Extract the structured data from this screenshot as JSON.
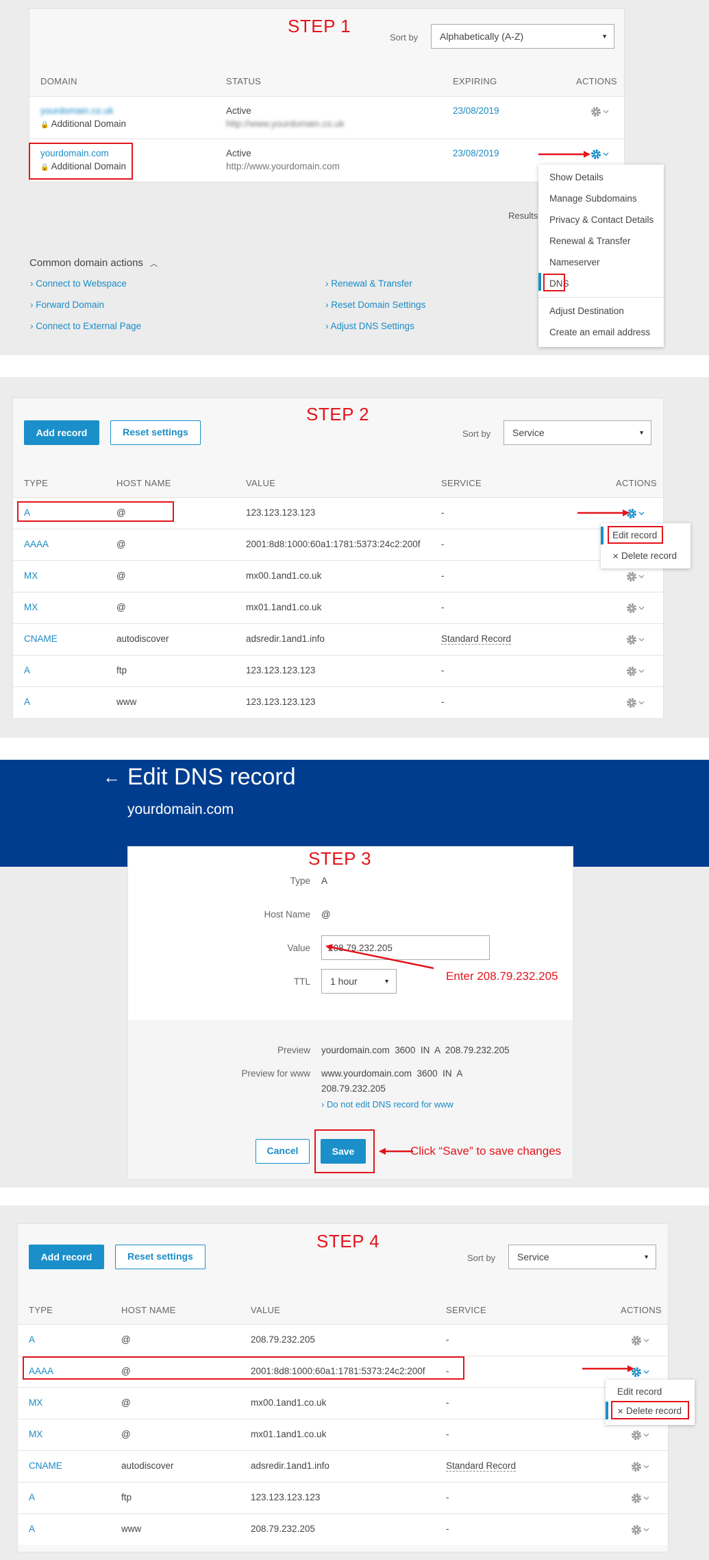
{
  "colors": {
    "accent": "#1a8fc9",
    "link": "#1a8cc6",
    "annotation": "#e3141b",
    "header_bg": "#003d8f"
  },
  "step1": {
    "title": "STEP 1",
    "sort_label": "Sort by",
    "sort_value": "Alphabetically (A-Z)",
    "headers": {
      "domain": "DOMAIN",
      "status": "STATUS",
      "expiring": "EXPIRING",
      "actions": "ACTIONS"
    },
    "rows": [
      {
        "domain": "yourdomain.co.uk",
        "sub": "Additional Domain",
        "status": "Active",
        "url": "http://www.yourdomain.co.uk",
        "expiring": "23/08/2019"
      },
      {
        "domain": "yourdomain.com",
        "sub": "Additional Domain",
        "status": "Active",
        "url": "http://www.yourdomain.com",
        "expiring": "23/08/2019"
      }
    ],
    "results_label": "Results",
    "common_title": "Common domain actions",
    "links_left": [
      "Connect to Webspace",
      "Forward Domain",
      "Connect to External Page"
    ],
    "links_right": [
      "Renewal & Transfer",
      "Reset Domain Settings",
      "Adjust DNS Settings"
    ],
    "menu": [
      "Show Details",
      "Manage Subdomains",
      "Privacy & Contact Details",
      "Renewal & Transfer",
      "Nameserver",
      "DNS",
      "Adjust Destination",
      "Create an email address"
    ]
  },
  "step2": {
    "title": "STEP 2",
    "add_record": "Add record",
    "reset_settings": "Reset settings",
    "sort_label": "Sort by",
    "sort_value": "Service",
    "headers": {
      "type": "TYPE",
      "host": "HOST NAME",
      "value": "VALUE",
      "service": "SERVICE",
      "actions": "ACTIONS"
    },
    "rows": [
      {
        "type": "A",
        "host": "@",
        "value": "123.123.123.123",
        "service": "-"
      },
      {
        "type": "AAAA",
        "host": "@",
        "value": "2001:8d8:1000:60a1:1781:5373:24c2:200f",
        "service": "-"
      },
      {
        "type": "MX",
        "host": "@",
        "value": "mx00.1and1.co.uk",
        "service": "-"
      },
      {
        "type": "MX",
        "host": "@",
        "value": "mx01.1and1.co.uk",
        "service": "-"
      },
      {
        "type": "CNAME",
        "host": "autodiscover",
        "value": "adsredir.1and1.info",
        "service": "Standard Record"
      },
      {
        "type": "A",
        "host": "ftp",
        "value": "123.123.123.123",
        "service": "-"
      },
      {
        "type": "A",
        "host": "www",
        "value": "123.123.123.123",
        "service": "-"
      }
    ],
    "menu": [
      "Edit record",
      "Delete record"
    ]
  },
  "step3": {
    "page_title": "Edit DNS record",
    "domain": "yourdomain.com",
    "title": "STEP 3",
    "type_label": "Type",
    "type_value": "A",
    "host_label": "Host Name",
    "host_value": "@",
    "value_label": "Value",
    "value_value": "208.79.232.205",
    "ttl_label": "TTL",
    "ttl_value": "1 hour",
    "annotation_value": "Enter 208.79.232.205",
    "preview_label": "Preview",
    "preview_value": "yourdomain.com  3600  IN  A  208.79.232.205",
    "preview_www_label": "Preview for www",
    "preview_www_line1": "www.yourdomain.com  3600  IN  A",
    "preview_www_line2": "208.79.232.205",
    "no_edit_www": "Do not edit DNS record for www",
    "cancel": "Cancel",
    "save": "Save",
    "annotation_save": "Click “Save” to save changes"
  },
  "step4": {
    "title": "STEP 4",
    "add_record": "Add record",
    "reset_settings": "Reset settings",
    "sort_label": "Sort by",
    "sort_value": "Service",
    "headers": {
      "type": "TYPE",
      "host": "HOST NAME",
      "value": "VALUE",
      "service": "SERVICE",
      "actions": "ACTIONS"
    },
    "rows": [
      {
        "type": "A",
        "host": "@",
        "value": "208.79.232.205",
        "service": "-"
      },
      {
        "type": "AAAA",
        "host": "@",
        "value": "2001:8d8:1000:60a1:1781:5373:24c2:200f",
        "service": "-"
      },
      {
        "type": "MX",
        "host": "@",
        "value": "mx00.1and1.co.uk",
        "service": "-"
      },
      {
        "type": "MX",
        "host": "@",
        "value": "mx01.1and1.co.uk",
        "service": "-"
      },
      {
        "type": "CNAME",
        "host": "autodiscover",
        "value": "adsredir.1and1.info",
        "service": "Standard Record"
      },
      {
        "type": "A",
        "host": "ftp",
        "value": "123.123.123.123",
        "service": "-"
      },
      {
        "type": "A",
        "host": "www",
        "value": "208.79.232.205",
        "service": "-"
      }
    ],
    "menu": [
      "Edit record",
      "Delete record"
    ]
  }
}
